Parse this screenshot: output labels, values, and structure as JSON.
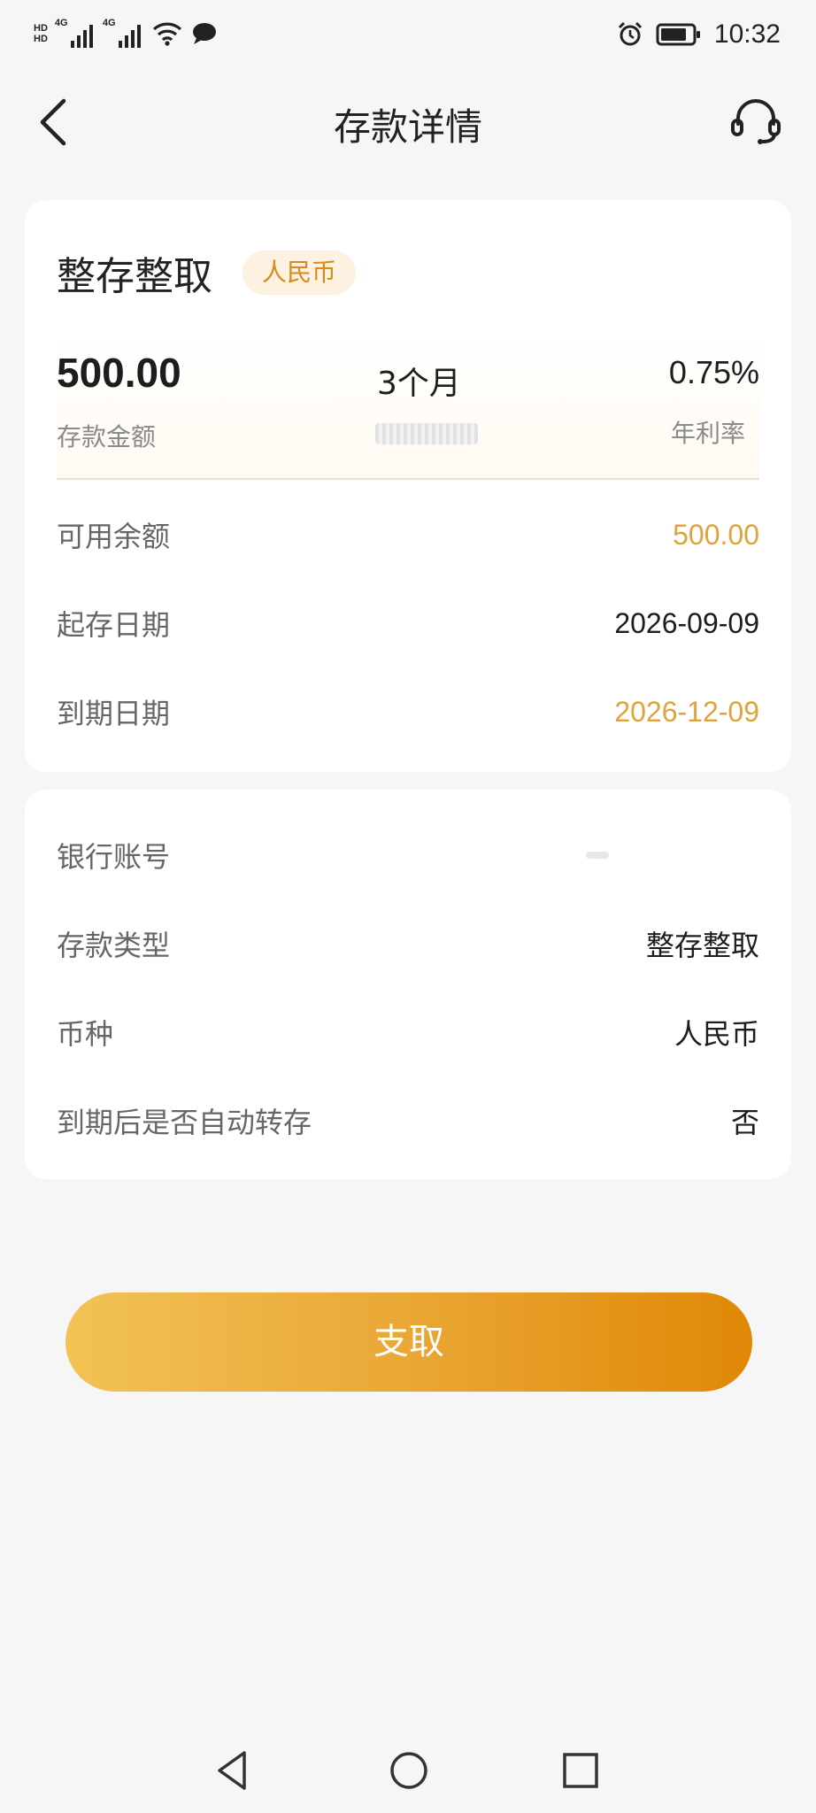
{
  "status_bar": {
    "hd_top": "HD",
    "hd_bottom": "HD",
    "signal1_label": "4G",
    "signal2_label": "4G",
    "time": "10:32",
    "icons": [
      "signal-icon",
      "wifi-icon",
      "message-icon",
      "alarm-icon",
      "battery-icon"
    ]
  },
  "header": {
    "title": "存款详情",
    "back_icon": "chevron-left-icon",
    "service_icon": "headset-icon"
  },
  "deposit": {
    "product_name": "整存整取",
    "currency_badge": "人民币",
    "amount": "500.00",
    "amount_label": "存款金额",
    "term": "3个月",
    "rate": "0.75%",
    "rate_label": "年利率"
  },
  "details_top": [
    {
      "key": "可用余额",
      "value": "500.00",
      "highlight": true
    },
    {
      "key": "起存日期",
      "value": "2026-09-09",
      "highlight": false
    },
    {
      "key": "到期日期",
      "value": "2026-12-09",
      "highlight": true
    }
  ],
  "details_bottom": [
    {
      "key": "银行账号",
      "value": ""
    },
    {
      "key": "存款类型",
      "value": "整存整取"
    },
    {
      "key": "币种",
      "value": "人民币"
    },
    {
      "key": "到期后是否自动转存",
      "value": "否"
    }
  ],
  "actions": {
    "withdraw_label": "支取"
  },
  "colors": {
    "accent": "#e0a23d",
    "button_start": "#f2c255",
    "button_end": "#e08806",
    "badge_bg": "#fdf1e1",
    "badge_text": "#d98a1c"
  },
  "nav": {
    "back": "triangle-back-icon",
    "home": "circle-home-icon",
    "recents": "square-recents-icon"
  }
}
